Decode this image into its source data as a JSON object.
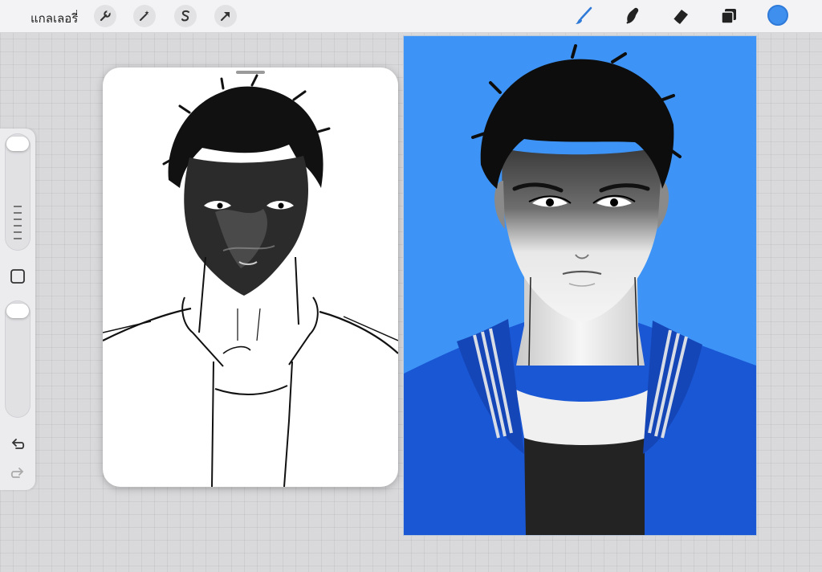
{
  "app": {
    "gallery_label": "แกลเลอรี่"
  },
  "toolbar": {
    "left_tools": [
      {
        "name": "actions",
        "icon": "wrench-icon"
      },
      {
        "name": "adjustments",
        "icon": "magic-wand-icon"
      },
      {
        "name": "selection",
        "icon": "selection-s-icon"
      },
      {
        "name": "transform",
        "icon": "arrow-cursor-icon"
      }
    ],
    "right_tools": [
      {
        "name": "brush",
        "icon": "brush-icon",
        "active": true
      },
      {
        "name": "smudge",
        "icon": "smudge-icon"
      },
      {
        "name": "eraser",
        "icon": "eraser-icon"
      },
      {
        "name": "layers",
        "icon": "layers-icon"
      }
    ],
    "current_color": "#3f8fef",
    "accent_color": "#2f7ad8"
  },
  "sidebar": {
    "items": [
      "brush-size-slider",
      "modify-square-button",
      "opacity-slider",
      "undo-icon",
      "redo-icon"
    ]
  },
  "canvas": {
    "background_color": "#3d94f6",
    "jacket_color": "#1a57d4"
  }
}
